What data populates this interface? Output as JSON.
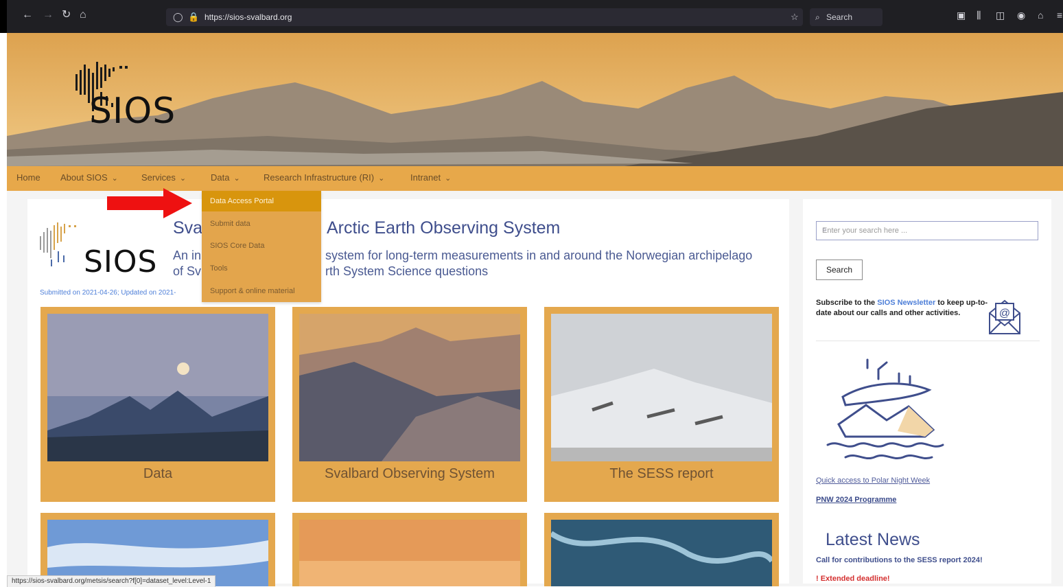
{
  "browser": {
    "url": "https://sios-svalbard.org",
    "search_placeholder": "Search",
    "status_url": "https://sios-svalbard.org/metsis/search?f[0]=dataset_level:Level-1"
  },
  "site": {
    "logo_text": "SIOS"
  },
  "nav": {
    "items": [
      {
        "label": "Home"
      },
      {
        "label": "About SIOS"
      },
      {
        "label": "Services"
      },
      {
        "label": "Data"
      },
      {
        "label": "Research Infrastructure (RI)"
      },
      {
        "label": "Intranet"
      }
    ]
  },
  "dropdown": {
    "items": [
      {
        "label": "Data Access Portal"
      },
      {
        "label": "Submit data"
      },
      {
        "label": "SIOS Core Data"
      },
      {
        "label": "Tools"
      },
      {
        "label": "Support & online material"
      }
    ]
  },
  "hero": {
    "title_left": "Sva",
    "title_right": "Arctic Earth Observing System",
    "line1_left": "An in",
    "line1_right": "system for long-term measurements in and around the Norwegian archipelago",
    "line2_left": "of Sv",
    "line2_right": "rth System Science questions",
    "submitted": "Submitted on 2021-04-26; Updated on 2021-"
  },
  "tiles": [
    {
      "label": "Data"
    },
    {
      "label": "Svalbard Observing System"
    },
    {
      "label": "The SESS report"
    }
  ],
  "sidebar": {
    "search_placeholder": "Enter your search here ...",
    "search_button": "Search",
    "newsletter_pre": "Subscribe to the ",
    "newsletter_link": "SIOS Newsletter",
    "newsletter_post": " to keep up-to-date about our calls and other activities.",
    "pnw_link": "Quick access to Polar Night Week",
    "pnw_programme": "PNW 2024 Programme",
    "latest_news": "Latest News",
    "news_item": "Call for contributions to the SESS report 2024!",
    "news_deadline": "! Extended deadline!"
  },
  "colors": {
    "nav_bg": "#e7a84a",
    "dropdown_active": "#d8950d",
    "heading": "#3f4e8c",
    "link": "#4e7fd8",
    "annotation_arrow": "#ee1111"
  },
  "icons": [
    "back-icon",
    "forward-icon",
    "reload-icon",
    "home-icon",
    "shield-icon",
    "lock-icon",
    "star-icon",
    "search-icon",
    "pocket-icon",
    "library-icon",
    "sidebar-icon",
    "account-icon",
    "extensions-icon",
    "menu-icon",
    "envelope-at-icon",
    "ice-floe-illustration-icon"
  ]
}
